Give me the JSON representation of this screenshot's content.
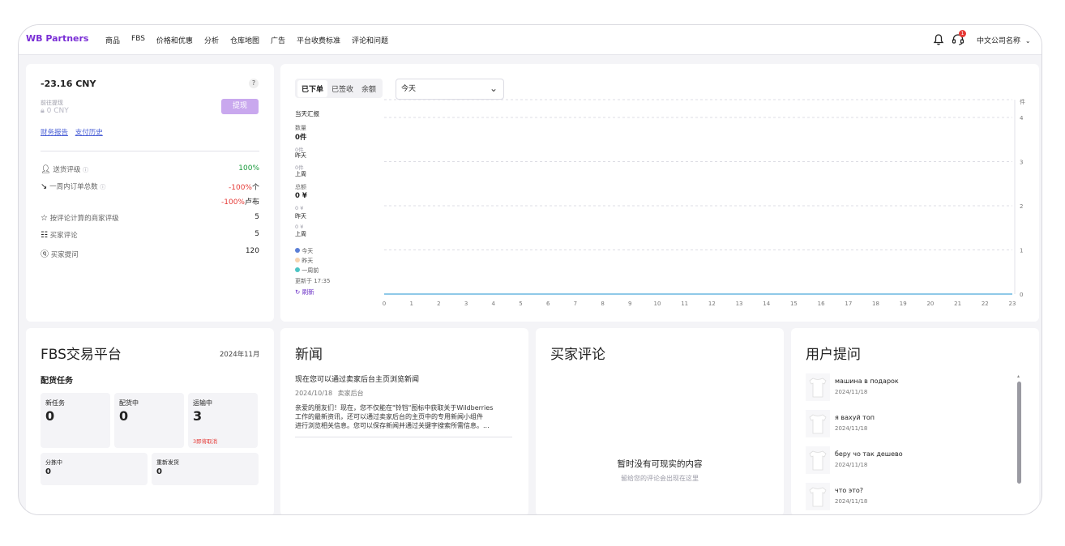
{
  "header": {
    "logo": "WB Partners",
    "nav": [
      "商品",
      "FBS",
      "价格和优惠",
      "分析",
      "仓库地图",
      "广告",
      "平台收费标准",
      "评论和问题"
    ],
    "notification_badge": "1",
    "company": "中文公司名称",
    "icons": {
      "bell": "bell-icon",
      "support": "headset-icon",
      "chevron": "chevron-down-icon"
    }
  },
  "balance": {
    "amount": "-23.16 CNY",
    "help": "?",
    "withdraw_label": "前往提现",
    "withdraw_amount": "0 CNY",
    "withdraw_button": "提现",
    "link_report": "财务报告",
    "link_history": "支付历史",
    "metrics": [
      {
        "label": "送货评级",
        "value": "100%",
        "color": "#1a9a3c"
      },
      {
        "label": "一周内订单总数",
        "value": "-100%",
        "unit": "个",
        "color": "#e53935"
      },
      {
        "label": "",
        "value": "-100%",
        "unit": "卢布",
        "color": "#e53935"
      },
      {
        "label": "按评论计算的商家评级",
        "value": "5",
        "color": "#222222"
      },
      {
        "label": "买家评论",
        "value": "5",
        "color": "#222222"
      },
      {
        "label": "买家提问",
        "value": "120",
        "color": "#222222"
      }
    ]
  },
  "chart_panel": {
    "tabs": [
      "已下单",
      "已签收",
      "余额"
    ],
    "active_tab": "已下单",
    "period": "今天",
    "summary": {
      "title": "当天汇报",
      "qty_label": "数量",
      "qty_today": "0件",
      "qty_yesterday_val": "0件",
      "qty_yesterday": "昨天",
      "qty_week_val": "0件",
      "qty_week": "上周",
      "sum_label": "总额",
      "sum_today": "0 ¥",
      "sum_yesterday_val": "0 ¥",
      "sum_yesterday": "昨天",
      "sum_week_val": "0 ¥",
      "sum_week": "上周"
    },
    "legend": [
      {
        "name": "今天",
        "color": "#5b7fd6"
      },
      {
        "name": "昨天",
        "color": "#f6d3b0"
      },
      {
        "name": "一周前",
        "color": "#4cc4c4"
      }
    ],
    "updated": "更新于 17:35",
    "refresh": "刷新",
    "right_axis_unit": "件"
  },
  "chart_data": {
    "type": "line",
    "x": [
      0,
      1,
      2,
      3,
      4,
      5,
      6,
      7,
      8,
      9,
      10,
      11,
      12,
      13,
      14,
      15,
      16,
      17,
      18,
      19,
      20,
      21,
      22,
      23
    ],
    "series": [
      {
        "name": "今天",
        "values": [
          0,
          0,
          0,
          0,
          0,
          0,
          0,
          0,
          0,
          0,
          0,
          0,
          0,
          0,
          0,
          0,
          0,
          0,
          0,
          0,
          0,
          0,
          0,
          0
        ]
      }
    ],
    "y_ticks": [
      0,
      1,
      2,
      3,
      4
    ],
    "ylim": [
      0,
      4
    ],
    "grid": true
  },
  "fbs": {
    "title": "FBS交易平台",
    "month": "2024年11月",
    "subtitle": "配货任务",
    "tiles": [
      {
        "label": "新任务",
        "value": "0"
      },
      {
        "label": "配货中",
        "value": "0"
      },
      {
        "label": "运输中",
        "value": "3",
        "note": "3即将取消"
      }
    ],
    "tiles2": [
      {
        "label": "分拣中",
        "value": "0"
      },
      {
        "label": "重新发货",
        "value": "0"
      }
    ]
  },
  "news": {
    "title": "新闻",
    "headline": "现在您可以通过卖家后台主页浏览新闻",
    "date": "2024/10/18",
    "source": "卖家后台",
    "body": [
      "亲爱的朋友们！现在，您不仅能在\"铃铛\"图标中获取关于Wildberries",
      "工作的最新资讯，还可以通过卖家后台的主页中的专用新闻小组件",
      "进行浏览相关信息。您可以保存新闻并通过关键字搜索所需信息。..."
    ]
  },
  "reviews": {
    "title": "买家评论",
    "empty_title": "暂时没有可现实的内容",
    "empty_sub": "留给您的评论会出现在这里"
  },
  "questions": {
    "title": "用户提问",
    "items": [
      {
        "text": "машина в подарок",
        "date": "2024/11/18"
      },
      {
        "text": "я вахуй топ",
        "date": "2024/11/18"
      },
      {
        "text": "беру чо так дешево",
        "date": "2024/11/18"
      },
      {
        "text": "что это?",
        "date": "2024/11/18"
      }
    ]
  }
}
